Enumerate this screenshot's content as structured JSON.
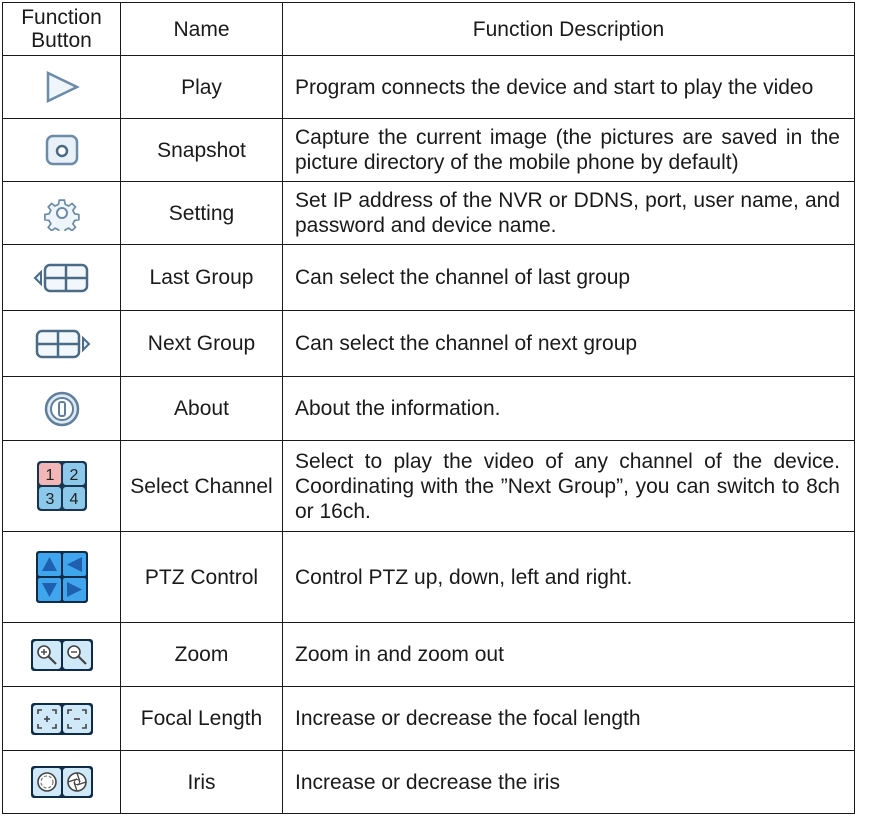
{
  "header": {
    "function_button": "Function Button",
    "name": "Name",
    "description": "Function Description"
  },
  "rows": [
    {
      "icon": "play-icon",
      "name": "Play",
      "description": "Program connects the device and start to play the video"
    },
    {
      "icon": "camera-icon",
      "name": "Snapshot",
      "description": "Capture the current image (the pictures are saved in the picture directory of the mobile phone by default)"
    },
    {
      "icon": "gear-icon",
      "name": "Setting",
      "description": "Set IP address of the NVR or DDNS, port, user name, and password and device name."
    },
    {
      "icon": "last-group-icon",
      "name": "Last Group",
      "description": "Can select the channel of last group"
    },
    {
      "icon": "next-group-icon",
      "name": "Next Group",
      "description": "Can select the channel of next group"
    },
    {
      "icon": "info-icon",
      "name": "About",
      "description": "About the information."
    },
    {
      "icon": "channel-grid-icon",
      "name": "Select Channel",
      "description": "Select to play the video of any channel of the device. Coordinating with the ”Next Group”, you can switch to 8ch or 16ch.",
      "channels": [
        "1",
        "2",
        "3",
        "4"
      ]
    },
    {
      "icon": "ptz-arrows-icon",
      "name": "PTZ Control",
      "description": "Control PTZ up, down, left and right."
    },
    {
      "icon": "zoom-icon",
      "name": "Zoom",
      "description": "Zoom in and zoom out"
    },
    {
      "icon": "focus-icon",
      "name": "Focal Length",
      "description": "Increase or decrease the focal length"
    },
    {
      "icon": "iris-icon",
      "name": "Iris",
      "description": "Increase or decrease the iris"
    }
  ],
  "colors": {
    "icon_outline": "#6b8ba6",
    "icon_fill": "#e8f1f8",
    "ptz_blue": "#1e8fe0",
    "channel_blue": "#8cc8ea",
    "channel_pink": "#f2b6b6"
  }
}
